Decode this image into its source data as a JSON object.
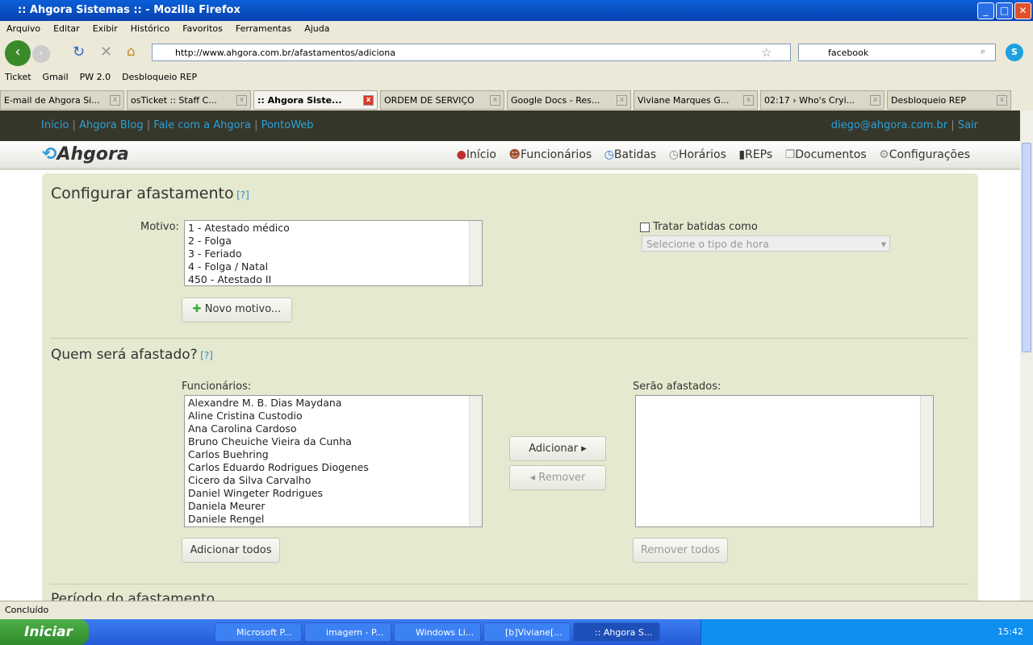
{
  "window": {
    "title": ":: Ahgora Sistemas :: - Mozilla Firefox"
  },
  "menu": [
    "Arquivo",
    "Editar",
    "Exibir",
    "Histórico",
    "Favoritos",
    "Ferramentas",
    "Ajuda"
  ],
  "url": "http://www.ahgora.com.br/afastamentos/adiciona",
  "search": "facebook",
  "bookmarks": [
    "Ticket",
    "Gmail",
    "PW 2.0",
    "Desbloqueio REP"
  ],
  "tabs": [
    "E-mail de Ahgora Si...",
    "osTicket :: Staff C...",
    ":: Ahgora Siste...",
    "ORDEM DE SERVIÇO",
    "Google Docs - Res...",
    "Viviane Marques G...",
    "02:17 › Who's Cryi...",
    "Desbloqueio REP"
  ],
  "top_links": [
    "Início",
    "Ahgora Blog",
    "Fale com a Ahgora",
    "PontoWeb"
  ],
  "user": {
    "email": "diego@ahgora.com.br",
    "logout": "Sair"
  },
  "logo": "Ahgora",
  "nav": [
    "Início",
    "Funcionários",
    "Batidas",
    "Horários",
    "REPs",
    "Documentos",
    "Configurações"
  ],
  "config": {
    "title": "Configurar afastamento",
    "help": "[?]",
    "motivo_label": "Motivo:",
    "motivos": [
      "1 - Atestado médico",
      "2 - Folga",
      "3 - Feriado",
      "4 - Folga / Natal",
      "450 - Atestado II"
    ],
    "novo_motivo": "Novo motivo...",
    "tratar": "Tratar batidas como",
    "tipo_hora": "Selecione o tipo de hora"
  },
  "quem": {
    "title": "Quem será afastado?",
    "help": "[?]",
    "funcionarios_label": "Funcionários:",
    "afastados_label": "Serão afastados:",
    "funcionarios": [
      "Alexandre M. B. Dias Maydana",
      "Aline Cristina Custodio",
      "Ana Carolina Cardoso",
      "Bruno Cheuiche Vieira da Cunha",
      "Carlos Buehring",
      "Carlos Eduardo Rodrigues Diogenes",
      "Cicero da Silva Carvalho",
      "Daniel Wingeter Rodrigues",
      "Daniela Meurer",
      "Daniele Rengel"
    ],
    "adicionar": "Adicionar ▸",
    "remover": "◂ Remover",
    "adicionar_todos": "Adicionar todos",
    "remover_todos": "Remover todos"
  },
  "periodo": {
    "title": "Período do afastamento"
  },
  "status": "Concluído",
  "taskbar": {
    "start": "Iniciar",
    "tasks": [
      "Microsoft P...",
      "imagem - P...",
      "Windows Li...",
      "[b]Viviane[...",
      ":: Ahgora S..."
    ],
    "clock": "15:42"
  }
}
